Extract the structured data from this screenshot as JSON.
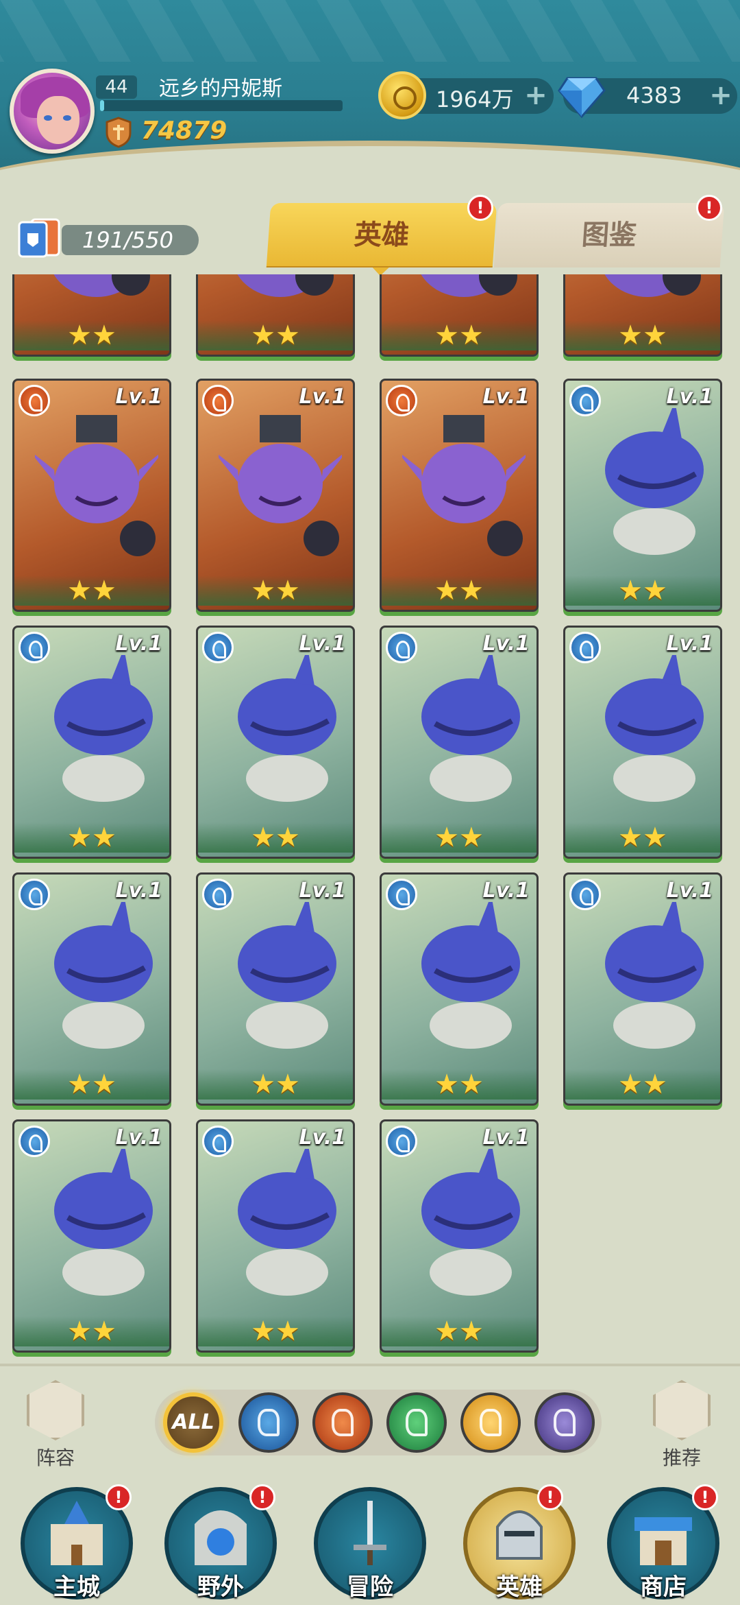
{
  "player": {
    "level": "44",
    "name": "远乡的丹妮斯",
    "power": "74879"
  },
  "resources": {
    "gold": "1964万",
    "gems": "4383",
    "plus": "+"
  },
  "hero_count": "191/550",
  "tabs": {
    "heroes": "英雄",
    "atlas": "图鉴",
    "alert": "!"
  },
  "cards": [
    {
      "faction": "fire",
      "level": "",
      "stars": "★★"
    },
    {
      "faction": "fire",
      "level": "",
      "stars": "★★"
    },
    {
      "faction": "fire",
      "level": "",
      "stars": "★★"
    },
    {
      "faction": "fire",
      "level": "",
      "stars": "★★"
    },
    {
      "faction": "fire",
      "level": "Lv.1",
      "stars": "★★"
    },
    {
      "faction": "fire",
      "level": "Lv.1",
      "stars": "★★"
    },
    {
      "faction": "fire",
      "level": "Lv.1",
      "stars": "★★"
    },
    {
      "faction": "water",
      "level": "Lv.1",
      "stars": "★★"
    },
    {
      "faction": "water",
      "level": "Lv.1",
      "stars": "★★"
    },
    {
      "faction": "water",
      "level": "Lv.1",
      "stars": "★★"
    },
    {
      "faction": "water",
      "level": "Lv.1",
      "stars": "★★"
    },
    {
      "faction": "water",
      "level": "Lv.1",
      "stars": "★★"
    },
    {
      "faction": "water",
      "level": "Lv.1",
      "stars": "★★"
    },
    {
      "faction": "water",
      "level": "Lv.1",
      "stars": "★★"
    },
    {
      "faction": "water",
      "level": "Lv.1",
      "stars": "★★"
    },
    {
      "faction": "water",
      "level": "Lv.1",
      "stars": "★★"
    },
    {
      "faction": "water",
      "level": "Lv.1",
      "stars": "★★"
    },
    {
      "faction": "water",
      "level": "Lv.1",
      "stars": "★★"
    },
    {
      "faction": "water",
      "level": "Lv.1",
      "stars": "★★"
    }
  ],
  "filters": {
    "lineup": "阵容",
    "all": "ALL",
    "recommend": "推荐",
    "elements": [
      "water-icon",
      "fire-icon",
      "wind-icon",
      "light-icon",
      "dark-icon"
    ]
  },
  "nav": {
    "main_city": "主城",
    "field": "野外",
    "adventure": "冒险",
    "heroes": "英雄",
    "shop": "商店"
  },
  "colors": {
    "header": "#2a7d8f",
    "gold_text": "#f6c744",
    "tab_active": "#f8d65a",
    "card_border_green": "#58a544",
    "alert": "#d92626"
  }
}
